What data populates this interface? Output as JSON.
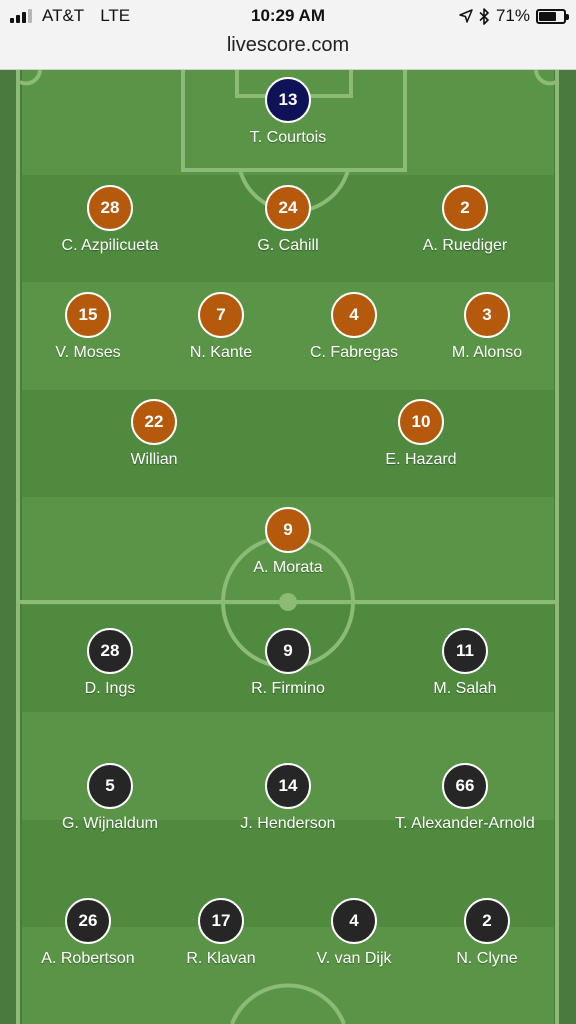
{
  "status_bar": {
    "carrier": "AT&T",
    "network": "LTE",
    "time": "10:29 AM",
    "battery_percent": "71%",
    "battery_level": 0.71,
    "url": "livescore.com"
  },
  "colors": {
    "pitch_light": "#5a9446",
    "pitch_dark": "#4f8a3e",
    "pitch_border": "#4a7a3d",
    "lines": "#8cba77",
    "home_kit": "#b55a0c",
    "goalkeeper_kit": "#0f1257",
    "away_kit": "#262626"
  },
  "home_team": {
    "goalkeeper": {
      "number": "13",
      "name": "T. Courtois"
    },
    "defenders": [
      {
        "number": "28",
        "name": "C. Azpilicueta"
      },
      {
        "number": "24",
        "name": "G. Cahill"
      },
      {
        "number": "2",
        "name": "A. Ruediger"
      }
    ],
    "midfielders": [
      {
        "number": "15",
        "name": "V. Moses"
      },
      {
        "number": "7",
        "name": "N. Kante"
      },
      {
        "number": "4",
        "name": "C. Fabregas"
      },
      {
        "number": "3",
        "name": "M. Alonso"
      }
    ],
    "attacking_midfielders": [
      {
        "number": "22",
        "name": "Willian"
      },
      {
        "number": "10",
        "name": "E. Hazard"
      }
    ],
    "forwards": [
      {
        "number": "9",
        "name": "A. Morata"
      }
    ]
  },
  "away_team": {
    "forwards": [
      {
        "number": "28",
        "name": "D. Ings"
      },
      {
        "number": "9",
        "name": "R. Firmino"
      },
      {
        "number": "11",
        "name": "M. Salah"
      }
    ],
    "midfielders": [
      {
        "number": "5",
        "name": "G. Wijnaldum"
      },
      {
        "number": "14",
        "name": "J. Henderson"
      },
      {
        "number": "66",
        "name": "T. Alexander-Arnold"
      }
    ],
    "defenders": [
      {
        "number": "26",
        "name": "A. Robertson"
      },
      {
        "number": "17",
        "name": "R. Klavan"
      },
      {
        "number": "4",
        "name": "V. van Dijk"
      },
      {
        "number": "2",
        "name": "N. Clyne"
      }
    ]
  }
}
